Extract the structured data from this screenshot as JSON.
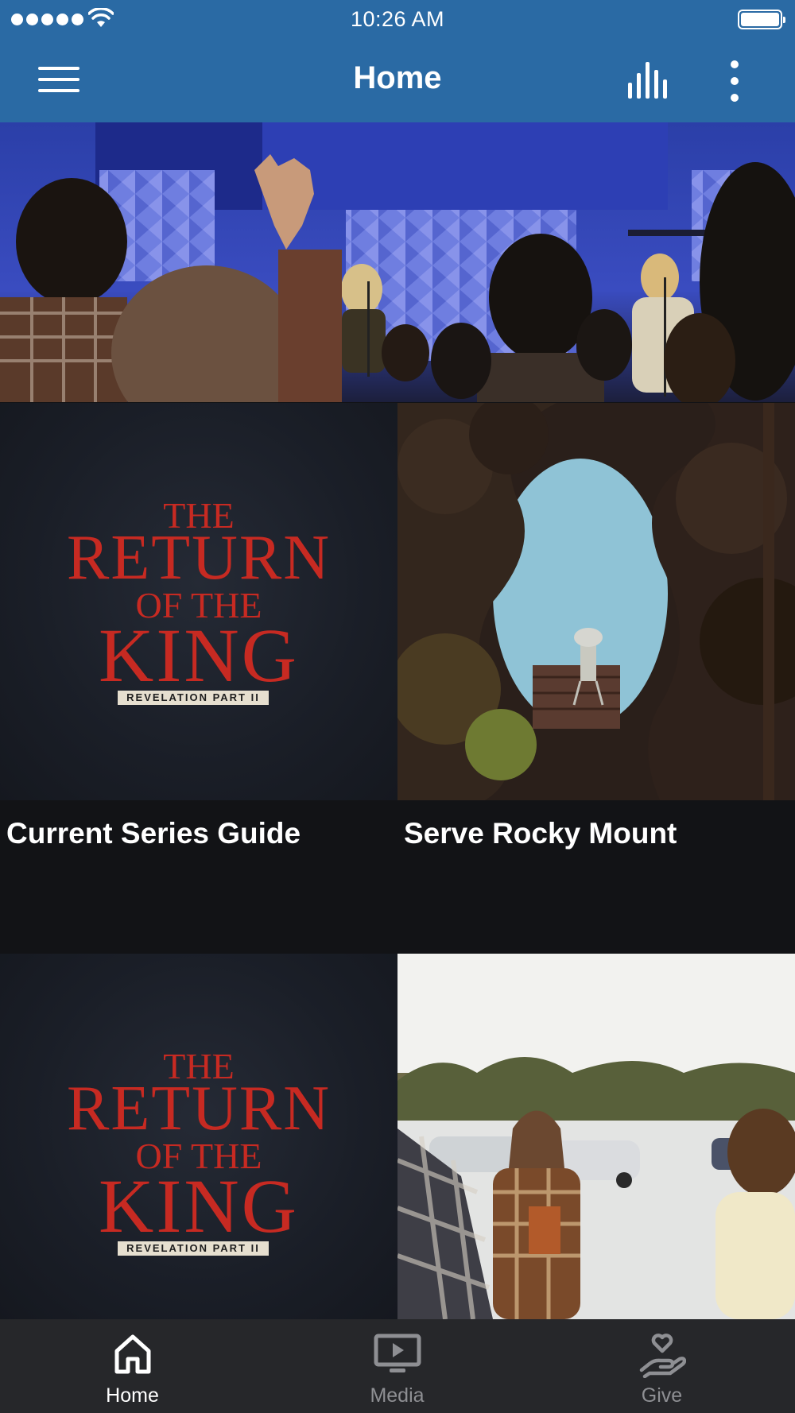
{
  "status_bar": {
    "time": "10:26 AM",
    "signal_icon": "cellular-signal-icon",
    "wifi_icon": "wifi-icon",
    "battery_icon": "battery-full-icon"
  },
  "nav": {
    "title": "Home",
    "menu_icon": "hamburger-menu-icon",
    "audio_icon": "audio-bars-icon",
    "more_icon": "more-vertical-icon",
    "bar_color": "#2a6aa4"
  },
  "tiles": [
    {
      "label": "Current Series Guide",
      "art": {
        "line1": "THE",
        "line2": "RETURN",
        "line3": "OF THE",
        "line4": "KING",
        "badge": "REVELATION PART II"
      }
    },
    {
      "label": "Serve Rocky Mount"
    },
    {
      "label": "",
      "art": {
        "line1": "THE",
        "line2": "RETURN",
        "line3": "OF THE",
        "line4": "KING",
        "badge": "REVELATION PART II"
      }
    },
    {
      "label": ""
    }
  ],
  "tabbar": {
    "items": [
      {
        "label": "Home",
        "icon": "home-icon",
        "active": true
      },
      {
        "label": "Media",
        "icon": "tv-play-icon",
        "active": false
      },
      {
        "label": "Give",
        "icon": "giving-hand-heart-icon",
        "active": false
      }
    ],
    "active_color": "#ffffff",
    "inactive_color": "#8e8f93"
  }
}
